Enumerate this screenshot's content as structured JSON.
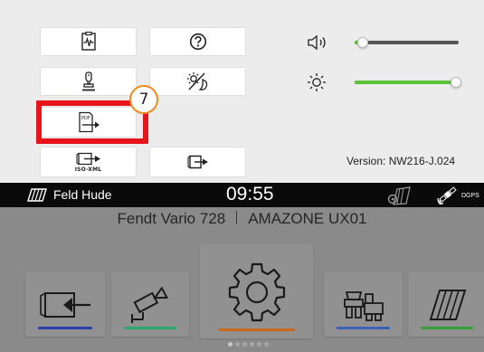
{
  "quick_menu": {
    "buttons": [
      {
        "icon": "diagnosis-icon",
        "label": ""
      },
      {
        "icon": "help-icon",
        "label": ""
      },
      {
        "icon": "joystick-icon",
        "label": ""
      },
      {
        "icon": "day-night-icon",
        "label": ""
      },
      {
        "icon": "pdf-export-icon",
        "label": ""
      },
      {
        "icon": "isoxml-export-icon",
        "label": "ISO-XML"
      },
      {
        "icon": "app-switch-icon",
        "label": ""
      }
    ],
    "volume": {
      "icon": "speaker-icon",
      "level": 0.08
    },
    "brightness": {
      "icon": "sun-icon",
      "level": 1.0
    },
    "version": "Version: NW216-J.024",
    "callout_number": "7",
    "colors": {
      "highlight": "#e8141c",
      "callout_border": "#f08a1a",
      "slider_fill": "#5bc23a"
    }
  },
  "status_bar": {
    "field_icon": "field-icon",
    "field_name": "Feld Hude",
    "time": "09:55",
    "steering_icon": "steering-icon",
    "gps_icon": "satellite-icon",
    "gps_label": "DGPS"
  },
  "home": {
    "tractor": "Fendt Vario 728",
    "implement": "AMAZONE UX01",
    "tiles": [
      {
        "icon": "connect-icon",
        "accent": "#2d3fa8"
      },
      {
        "icon": "camera-icon",
        "accent": "#2aa86a"
      },
      {
        "icon": "settings-gear-icon",
        "accent": "#c86a1e"
      },
      {
        "icon": "machine-icon",
        "accent": "#3e61b8"
      },
      {
        "icon": "field-icon",
        "accent": "#35a03a"
      }
    ],
    "page_count": 6,
    "active_page": 1
  }
}
